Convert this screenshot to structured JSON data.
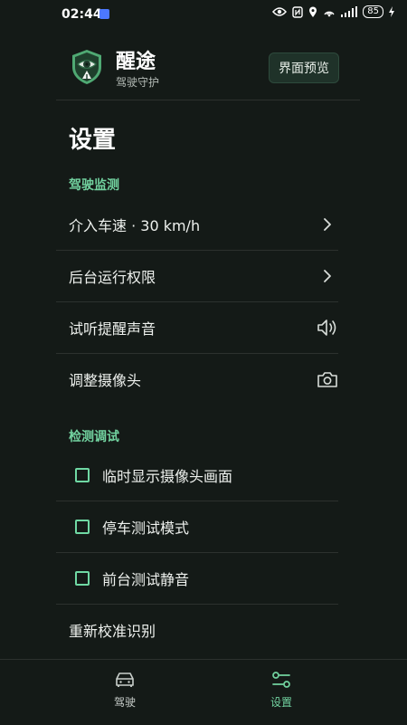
{
  "status": {
    "time": "02:44",
    "battery": "85"
  },
  "header": {
    "app_name": "醒途",
    "subtitle": "驾驶守护",
    "preview_button": "界面预览"
  },
  "page": {
    "title": "设置"
  },
  "sections": {
    "driving": {
      "title": "驾驶监测"
    },
    "debug": {
      "title": "检测调试"
    }
  },
  "rows": {
    "speed": "介入车速 · 30 km/h",
    "background": "后台运行权限",
    "sound": "试听提醒声音",
    "camera": "调整摄像头",
    "show_camera": "临时显示摄像头画面",
    "park_test": "停车测试模式",
    "mute_test": "前台测试静音",
    "recalibrate": "重新校准识别"
  },
  "nav": {
    "driving": "驾驶",
    "settings": "设置"
  },
  "colors": {
    "accent": "#72d3a0",
    "background": "#141a17"
  },
  "icons": [
    "chevron-right-icon",
    "speaker-icon",
    "camera-icon",
    "car-icon",
    "settings-sliders-icon"
  ]
}
